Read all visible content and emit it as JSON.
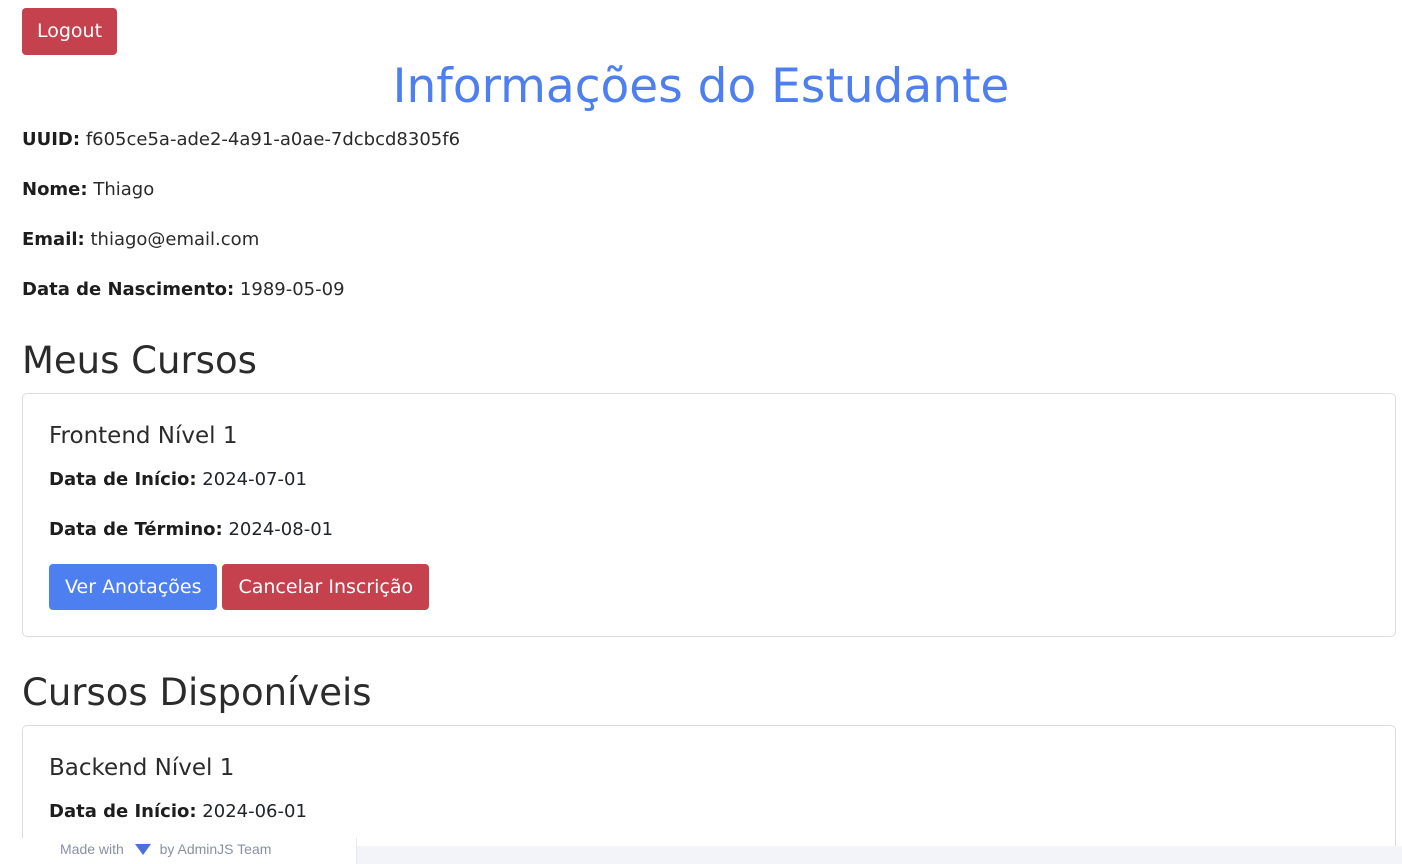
{
  "header": {
    "logout_label": "Logout"
  },
  "page_title": "Informações do Estudante",
  "student": {
    "uuid_label": "UUID:",
    "uuid_value": "f605ce5a-ade2-4a91-a0ae-7dcbcd8305f6",
    "name_label": "Nome:",
    "name_value": "Thiago",
    "email_label": "Email:",
    "email_value": "thiago@email.com",
    "birth_label": "Data de Nascimento:",
    "birth_value": "1989-05-09"
  },
  "my_courses": {
    "heading": "Meus Cursos",
    "items": [
      {
        "title": "Frontend Nível 1",
        "start_label": "Data de Início:",
        "start_value": "2024-07-01",
        "end_label": "Data de Término:",
        "end_value": "2024-08-01",
        "notes_button": "Ver Anotações",
        "cancel_button": "Cancelar Inscrição"
      }
    ]
  },
  "available_courses": {
    "heading": "Cursos Disponíveis",
    "items": [
      {
        "title": "Backend Nível 1",
        "start_label": "Data de Início:",
        "start_value": "2024-06-01"
      }
    ]
  },
  "footer": {
    "made_with": "Made with",
    "by_team": "by AdminJS Team"
  },
  "colors": {
    "primary": "#4d7ff0",
    "danger": "#c4414d",
    "footer_text": "#8a8fa3",
    "footer_bg": "#f3f4f9"
  }
}
